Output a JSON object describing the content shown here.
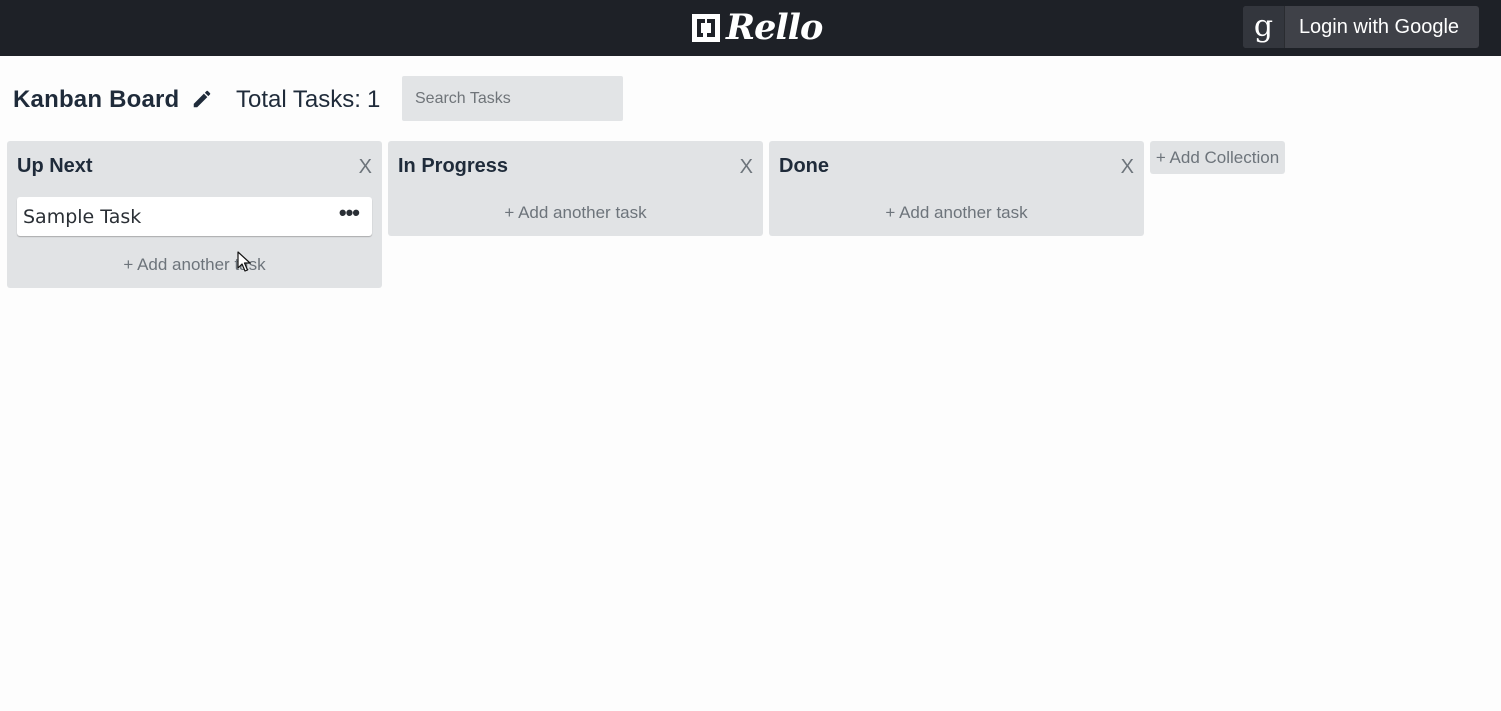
{
  "app": {
    "name": "Rello",
    "login_label": "Login with Google",
    "login_icon_glyph": "g"
  },
  "board": {
    "title": "Kanban Board",
    "total_tasks_label": "Total Tasks:",
    "total_tasks_count": "1",
    "search_placeholder": "Search Tasks"
  },
  "columns": [
    {
      "title": "Up Next",
      "close_label": "X",
      "tasks": [
        {
          "title": "Sample Task",
          "menu_label": "•••"
        }
      ],
      "add_task_label": "+ Add another task"
    },
    {
      "title": "In Progress",
      "close_label": "X",
      "tasks": [],
      "add_task_label": "+ Add another task"
    },
    {
      "title": "Done",
      "close_label": "X",
      "tasks": [],
      "add_task_label": "+ Add another task"
    }
  ],
  "add_collection_label": "+ Add Collection",
  "icons": {
    "brand": "rello-logo-icon",
    "login": "google-g-icon",
    "edit": "pencil-icon",
    "cursor": "mouse-pointer-icon"
  },
  "colors": {
    "topbar": "#1e2127",
    "column_bg": "#e1e3e5",
    "card_bg": "#ffffff",
    "muted_text": "#6d747b",
    "title_text": "#1f2b3a"
  }
}
